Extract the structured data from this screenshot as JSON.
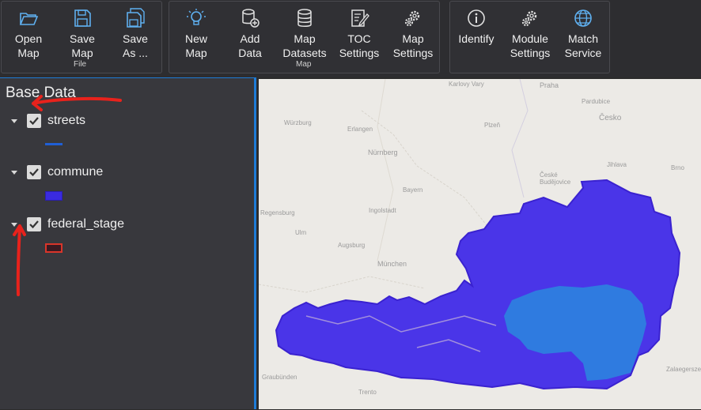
{
  "ribbon": {
    "file": {
      "label": "File",
      "buttons": [
        {
          "label": "Open\nMap",
          "icon": "folder-open-icon"
        },
        {
          "label": "Save\nMap",
          "icon": "save-icon"
        },
        {
          "label": "Save\nAs ...",
          "icon": "save-as-icon"
        }
      ]
    },
    "map": {
      "label": "Map",
      "buttons": [
        {
          "label": "New\nMap",
          "icon": "lightbulb-icon"
        },
        {
          "label": "Add\nData",
          "icon": "add-database-icon"
        },
        {
          "label": "Map\nDatasets",
          "icon": "database-icon"
        },
        {
          "label": "TOC\nSettings",
          "icon": "edit-document-icon"
        },
        {
          "label": "Map\nSettings",
          "icon": "gears-icon"
        }
      ]
    },
    "tools": {
      "buttons": [
        {
          "label": "Identify",
          "icon": "info-icon"
        },
        {
          "label": "Module\nSettings",
          "icon": "gears-icon"
        },
        {
          "label": "Match\nService",
          "icon": "globe-icon"
        }
      ]
    }
  },
  "sidebar": {
    "title": "Base Data",
    "layers": [
      {
        "name": "streets",
        "checked": true,
        "legend": "line",
        "color": "#1f5fd6"
      },
      {
        "name": "commune",
        "checked": true,
        "legend": "fill",
        "color": "#3a2be0"
      },
      {
        "name": "federal_stage",
        "checked": true,
        "legend": "fill-outline",
        "color": "#d9352a"
      }
    ]
  },
  "map": {
    "cities": [
      "Karlovy Vary",
      "Praha",
      "Pardubice",
      "Česko",
      "Würzburg",
      "Erlangen",
      "Plzeň",
      "Nürnberg",
      "České Budějovice",
      "Brno",
      "Bayern",
      "Ingolstadt",
      "Regensburg",
      "Ulm",
      "Augsburg",
      "München",
      "Jihlava",
      "Zalaegerszeg",
      "Graubünden",
      "Trento"
    ],
    "colors": {
      "water": "#eceae6",
      "commune": "#4a35e8",
      "federal_stage": "#2f7be0",
      "streets": "#b8a6d8"
    }
  },
  "colors": {
    "accent": "#1e7bd6",
    "annotation": "#e8221c"
  }
}
